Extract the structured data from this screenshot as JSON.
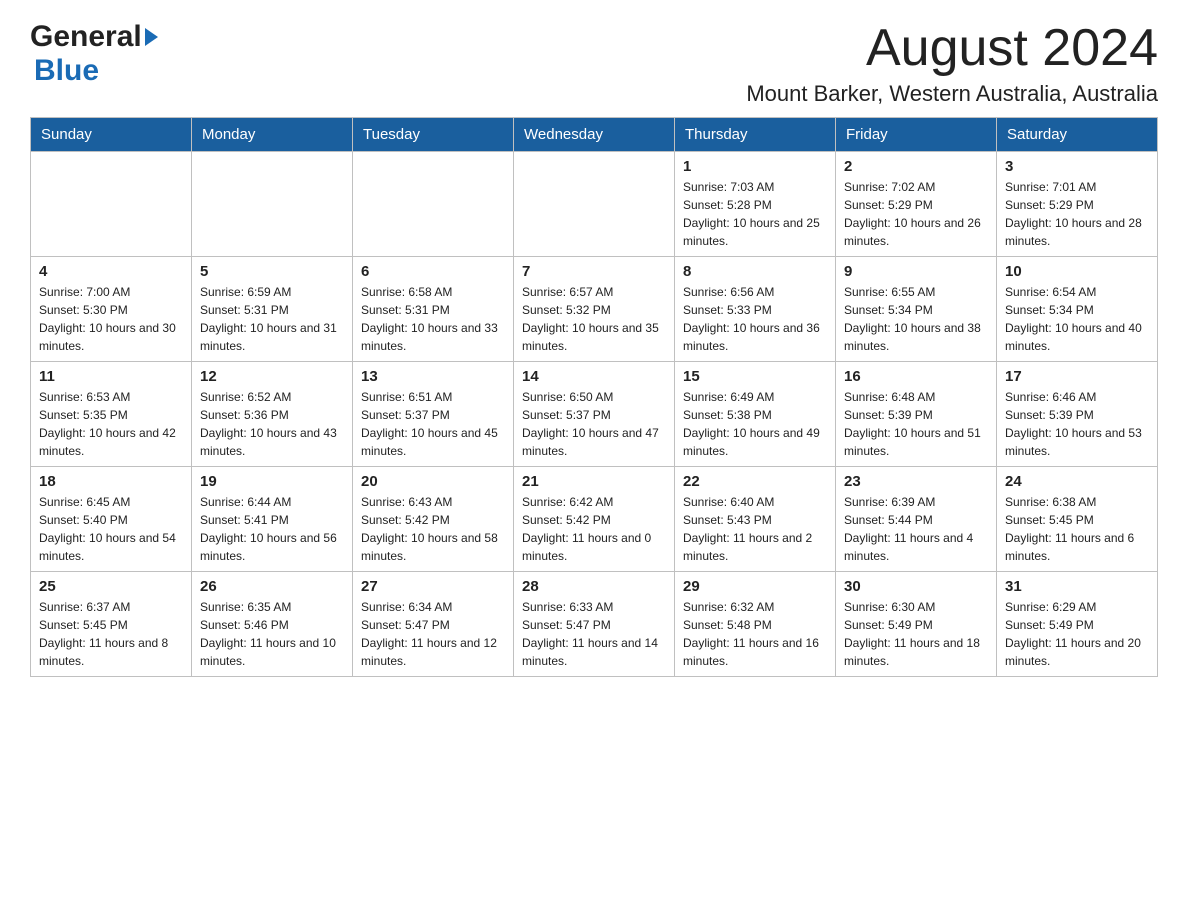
{
  "header": {
    "logo_general": "General",
    "logo_blue": "Blue",
    "month_title": "August 2024",
    "location": "Mount Barker, Western Australia, Australia"
  },
  "days_of_week": [
    "Sunday",
    "Monday",
    "Tuesday",
    "Wednesday",
    "Thursday",
    "Friday",
    "Saturday"
  ],
  "weeks": [
    [
      {
        "day": "",
        "info": ""
      },
      {
        "day": "",
        "info": ""
      },
      {
        "day": "",
        "info": ""
      },
      {
        "day": "",
        "info": ""
      },
      {
        "day": "1",
        "info": "Sunrise: 7:03 AM\nSunset: 5:28 PM\nDaylight: 10 hours and 25 minutes."
      },
      {
        "day": "2",
        "info": "Sunrise: 7:02 AM\nSunset: 5:29 PM\nDaylight: 10 hours and 26 minutes."
      },
      {
        "day": "3",
        "info": "Sunrise: 7:01 AM\nSunset: 5:29 PM\nDaylight: 10 hours and 28 minutes."
      }
    ],
    [
      {
        "day": "4",
        "info": "Sunrise: 7:00 AM\nSunset: 5:30 PM\nDaylight: 10 hours and 30 minutes."
      },
      {
        "day": "5",
        "info": "Sunrise: 6:59 AM\nSunset: 5:31 PM\nDaylight: 10 hours and 31 minutes."
      },
      {
        "day": "6",
        "info": "Sunrise: 6:58 AM\nSunset: 5:31 PM\nDaylight: 10 hours and 33 minutes."
      },
      {
        "day": "7",
        "info": "Sunrise: 6:57 AM\nSunset: 5:32 PM\nDaylight: 10 hours and 35 minutes."
      },
      {
        "day": "8",
        "info": "Sunrise: 6:56 AM\nSunset: 5:33 PM\nDaylight: 10 hours and 36 minutes."
      },
      {
        "day": "9",
        "info": "Sunrise: 6:55 AM\nSunset: 5:34 PM\nDaylight: 10 hours and 38 minutes."
      },
      {
        "day": "10",
        "info": "Sunrise: 6:54 AM\nSunset: 5:34 PM\nDaylight: 10 hours and 40 minutes."
      }
    ],
    [
      {
        "day": "11",
        "info": "Sunrise: 6:53 AM\nSunset: 5:35 PM\nDaylight: 10 hours and 42 minutes."
      },
      {
        "day": "12",
        "info": "Sunrise: 6:52 AM\nSunset: 5:36 PM\nDaylight: 10 hours and 43 minutes."
      },
      {
        "day": "13",
        "info": "Sunrise: 6:51 AM\nSunset: 5:37 PM\nDaylight: 10 hours and 45 minutes."
      },
      {
        "day": "14",
        "info": "Sunrise: 6:50 AM\nSunset: 5:37 PM\nDaylight: 10 hours and 47 minutes."
      },
      {
        "day": "15",
        "info": "Sunrise: 6:49 AM\nSunset: 5:38 PM\nDaylight: 10 hours and 49 minutes."
      },
      {
        "day": "16",
        "info": "Sunrise: 6:48 AM\nSunset: 5:39 PM\nDaylight: 10 hours and 51 minutes."
      },
      {
        "day": "17",
        "info": "Sunrise: 6:46 AM\nSunset: 5:39 PM\nDaylight: 10 hours and 53 minutes."
      }
    ],
    [
      {
        "day": "18",
        "info": "Sunrise: 6:45 AM\nSunset: 5:40 PM\nDaylight: 10 hours and 54 minutes."
      },
      {
        "day": "19",
        "info": "Sunrise: 6:44 AM\nSunset: 5:41 PM\nDaylight: 10 hours and 56 minutes."
      },
      {
        "day": "20",
        "info": "Sunrise: 6:43 AM\nSunset: 5:42 PM\nDaylight: 10 hours and 58 minutes."
      },
      {
        "day": "21",
        "info": "Sunrise: 6:42 AM\nSunset: 5:42 PM\nDaylight: 11 hours and 0 minutes."
      },
      {
        "day": "22",
        "info": "Sunrise: 6:40 AM\nSunset: 5:43 PM\nDaylight: 11 hours and 2 minutes."
      },
      {
        "day": "23",
        "info": "Sunrise: 6:39 AM\nSunset: 5:44 PM\nDaylight: 11 hours and 4 minutes."
      },
      {
        "day": "24",
        "info": "Sunrise: 6:38 AM\nSunset: 5:45 PM\nDaylight: 11 hours and 6 minutes."
      }
    ],
    [
      {
        "day": "25",
        "info": "Sunrise: 6:37 AM\nSunset: 5:45 PM\nDaylight: 11 hours and 8 minutes."
      },
      {
        "day": "26",
        "info": "Sunrise: 6:35 AM\nSunset: 5:46 PM\nDaylight: 11 hours and 10 minutes."
      },
      {
        "day": "27",
        "info": "Sunrise: 6:34 AM\nSunset: 5:47 PM\nDaylight: 11 hours and 12 minutes."
      },
      {
        "day": "28",
        "info": "Sunrise: 6:33 AM\nSunset: 5:47 PM\nDaylight: 11 hours and 14 minutes."
      },
      {
        "day": "29",
        "info": "Sunrise: 6:32 AM\nSunset: 5:48 PM\nDaylight: 11 hours and 16 minutes."
      },
      {
        "day": "30",
        "info": "Sunrise: 6:30 AM\nSunset: 5:49 PM\nDaylight: 11 hours and 18 minutes."
      },
      {
        "day": "31",
        "info": "Sunrise: 6:29 AM\nSunset: 5:49 PM\nDaylight: 11 hours and 20 minutes."
      }
    ]
  ]
}
